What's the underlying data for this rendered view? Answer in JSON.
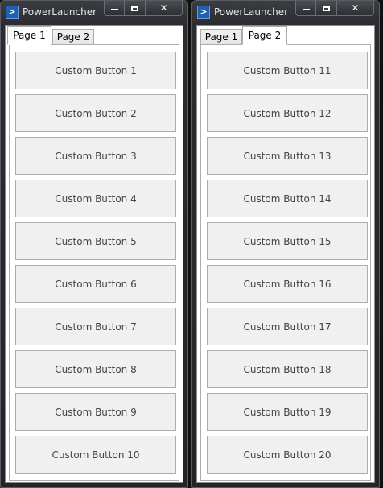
{
  "windows": [
    {
      "title": "PowerLauncher",
      "icon": "powershell-icon",
      "controls": {
        "minimize": "minimize",
        "maximize": "maximize",
        "close": "✕"
      },
      "tabs": [
        {
          "label": "Page 1",
          "active": true
        },
        {
          "label": "Page 2",
          "active": false
        }
      ],
      "buttons": [
        "Custom Button 1",
        "Custom Button 2",
        "Custom Button 3",
        "Custom Button 4",
        "Custom Button 5",
        "Custom Button 6",
        "Custom Button 7",
        "Custom Button 8",
        "Custom Button 9",
        "Custom Button 10"
      ]
    },
    {
      "title": "PowerLauncher",
      "icon": "powershell-icon",
      "controls": {
        "minimize": "minimize",
        "maximize": "maximize",
        "close": "✕"
      },
      "tabs": [
        {
          "label": "Page 1",
          "active": false
        },
        {
          "label": "Page 2",
          "active": true
        }
      ],
      "buttons": [
        "Custom Button 11",
        "Custom Button 12",
        "Custom Button 13",
        "Custom Button 14",
        "Custom Button 15",
        "Custom Button 16",
        "Custom Button 17",
        "Custom Button 18",
        "Custom Button 19",
        "Custom Button 20"
      ]
    }
  ],
  "colors": {
    "title_text": "#e8e8e8",
    "app_icon": "#1f5fb0",
    "button_face": "#f0f0f0"
  }
}
